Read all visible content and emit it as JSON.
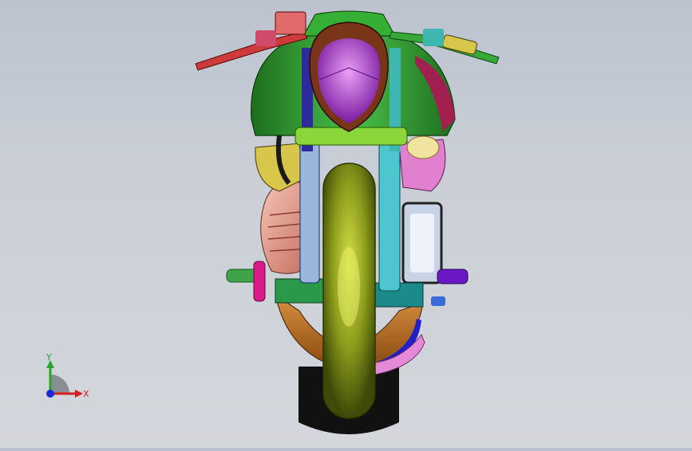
{
  "viewport": {
    "background_top": "#bcc3cf",
    "background_bottom": "#d4d7dc"
  },
  "triad": {
    "x_label": "X",
    "y_label": "Y",
    "x_color": "#d42020",
    "y_color": "#2aa52a",
    "z_color": "#1a2ad8"
  },
  "model": {
    "colors": {
      "tire": "#111111",
      "wheel": "#8a9a1a",
      "tank": "#2e9a2e",
      "headlight": "#a92fd0",
      "headlight_rim": "#7a3418",
      "fork_left": "#2d2a9a",
      "fork_right": "#3fb6b0",
      "engine": "#e19a8a",
      "handlebar_left": "#cc3a3a",
      "handlebar_right": "#38a838",
      "fender_pink": "#e58ad8",
      "exhaust": "#d9b14a",
      "pegs_left": "#3fa34a",
      "pegs_right": "#6a18c4",
      "belly_pan": "#b3651f"
    }
  }
}
